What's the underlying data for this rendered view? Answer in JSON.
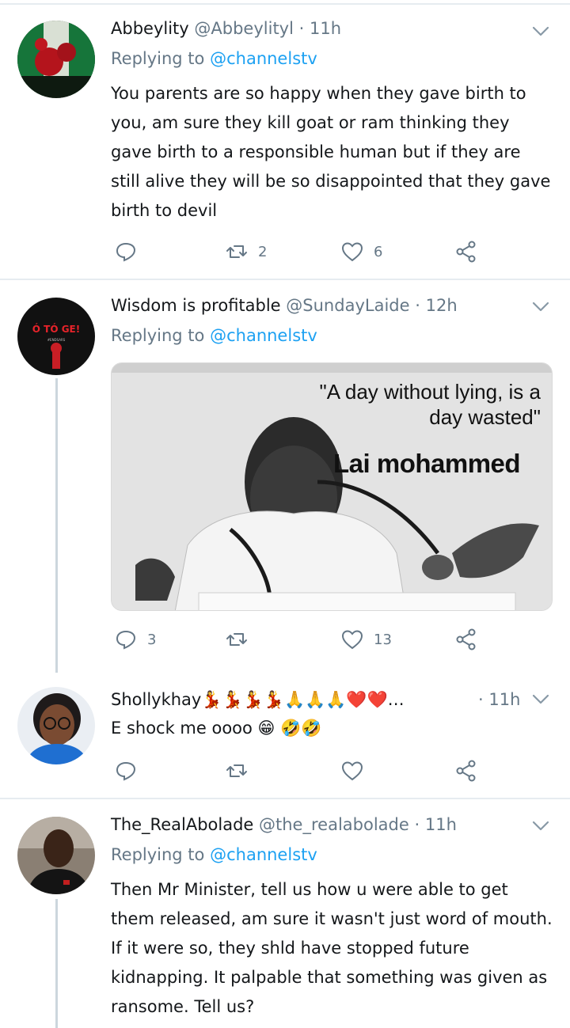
{
  "tweets": [
    {
      "name": "Abbeylity",
      "handle": "@Abbeylityl",
      "time": "11h",
      "replying_label": "Replying to",
      "replying_to": "@channelstv",
      "text": "You parents are so happy when they gave birth to you, am sure they kill goat or ram thinking they gave birth to a responsible human but if they are still alive they will be so disappointed that they gave birth to devil",
      "retweets": "2",
      "likes": "6"
    },
    {
      "name": "Wisdom is profitable",
      "handle": "@SundayLaide",
      "time": "12h",
      "replying_label": "Replying to",
      "replying_to": "@channelstv",
      "avatar_text": "Ó TÓ GE!",
      "avatar_sub": "#ENDSARS",
      "image_quote": "\"A day without lying, is a day wasted\"",
      "image_caption": "Lai mohammed",
      "replies": "3",
      "likes": "13"
    },
    {
      "name": "Shollykhay💃💃💃💃🙏🙏🙏❤️❤️…",
      "time": "11h",
      "text": "E shock me oooo 😁 🤣🤣"
    },
    {
      "name": "The_RealAbolade",
      "handle": "@the_realabolade",
      "time": "11h",
      "replying_label": "Replying to",
      "replying_to": "@channelstv",
      "text": "Then Mr Minister, tell us how u were able to get them released, am sure it wasn't just word of mouth. If it were so, they shld have stopped future kidnapping. It palpable that something was given as ransome. Tell us?"
    }
  ],
  "separator": "·",
  "colors": {
    "text": "#14171a",
    "secondary": "#657786",
    "link": "#1da1f2",
    "divider": "#e6ecf0"
  },
  "icons": [
    "reply-icon",
    "retweet-icon",
    "like-icon",
    "share-icon",
    "chevron-down-icon"
  ]
}
